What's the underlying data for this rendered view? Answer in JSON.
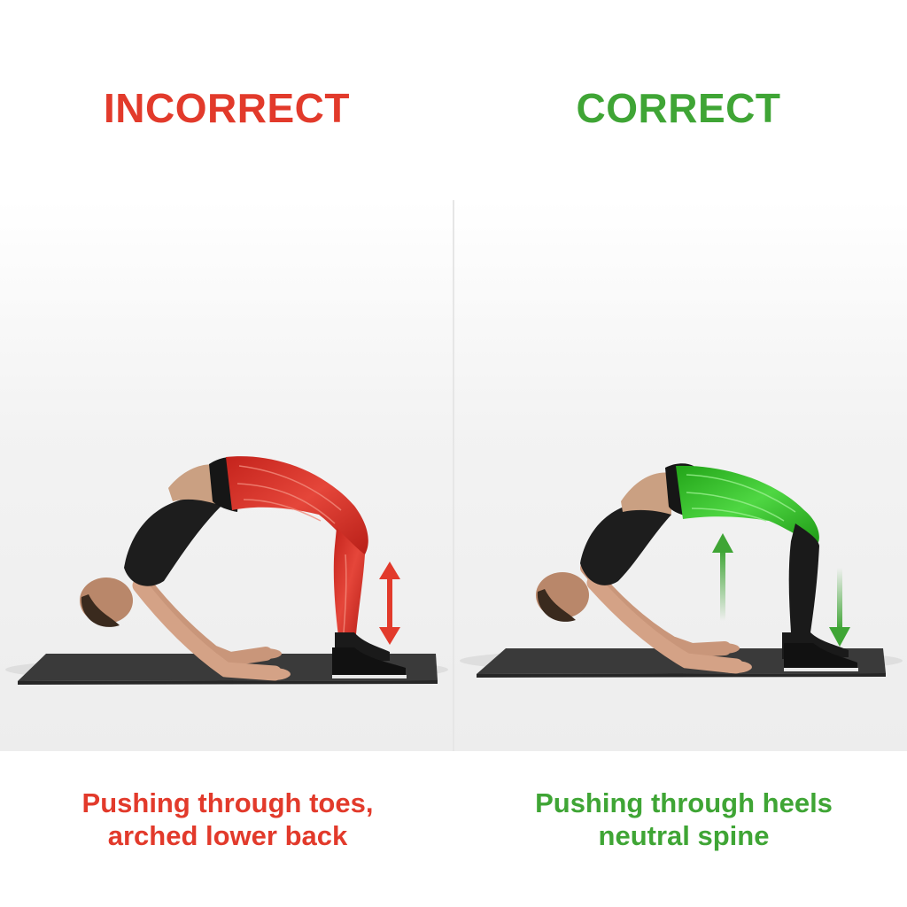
{
  "left": {
    "title": "INCORRECT",
    "caption_line1": "Pushing through toes,",
    "caption_line2": "arched lower back",
    "accent_color": "#e23a2b",
    "muscle_color": "#d8322a",
    "arrow_icon": "double-arrow-vertical"
  },
  "right": {
    "title": "CORRECT",
    "caption_line1": "Pushing through heels",
    "caption_line2": "neutral spine",
    "accent_color": "#3fa535",
    "muscle_color": "#36c42c",
    "arrow_icons": [
      "arrow-up",
      "arrow-down"
    ]
  }
}
